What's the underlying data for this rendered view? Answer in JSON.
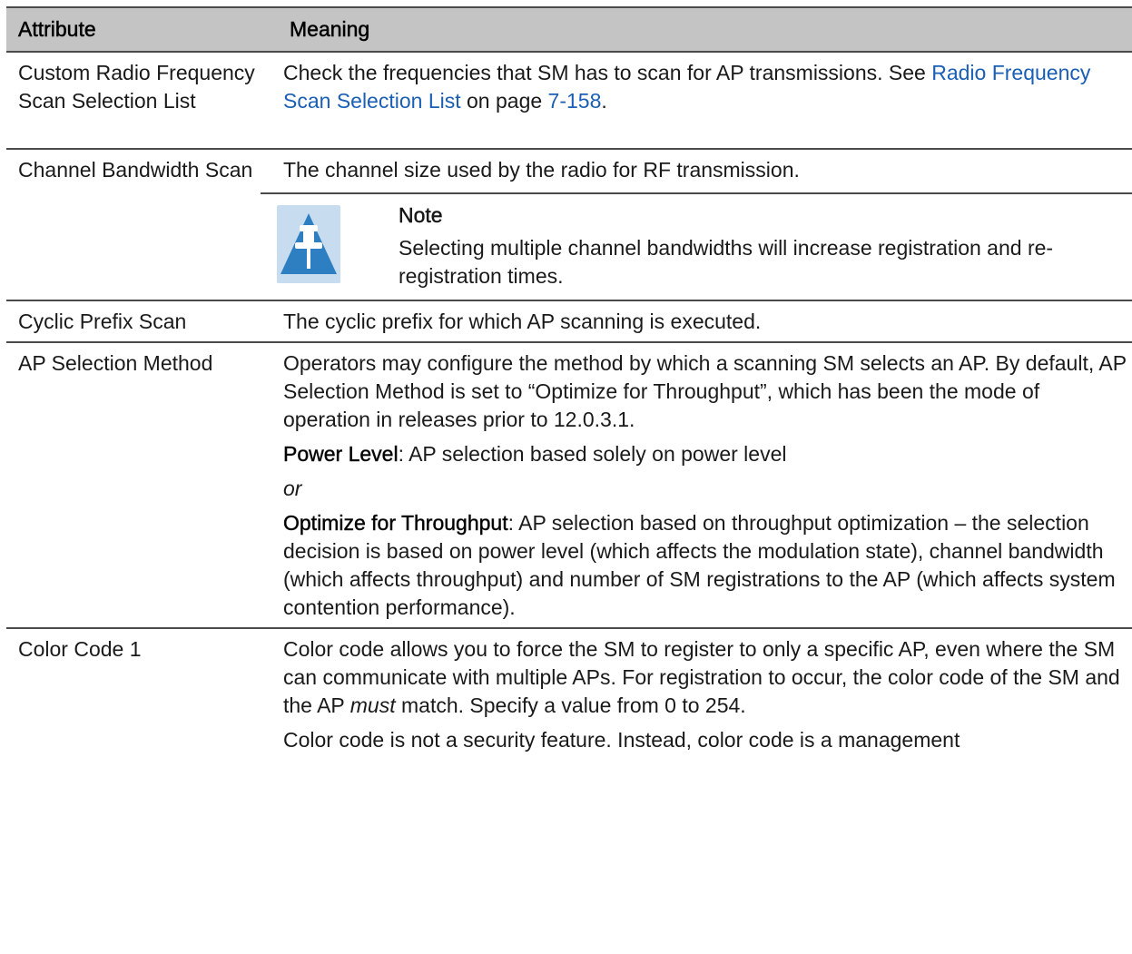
{
  "table": {
    "headers": [
      "Attribute",
      "Meaning"
    ],
    "rows": [
      {
        "attribute": "Custom Radio Frequency Scan Selection List",
        "meaning": {
          "text_before": "Check the frequencies that SM has to scan for AP transmissions. See ",
          "link1": "Radio Frequency Scan Selection List",
          "text_mid": " on page ",
          "link2": "7-158",
          "text_after": "."
        }
      },
      {
        "attribute": "Channel Bandwidth Scan",
        "meaning": {
          "text": "The channel size used by the radio for RF transmission.",
          "note_title": "Note",
          "note_text": "Selecting multiple channel bandwidths will increase registration and re-registration times."
        }
      },
      {
        "attribute": "Cyclic Prefix Scan",
        "meaning": {
          "text": "The cyclic prefix for which AP scanning is executed."
        }
      },
      {
        "attribute": "AP Selection Method",
        "meaning": {
          "p1": "Operators may configure the method by which a scanning SM selects an AP. By default, AP Selection Method is set to “Optimize for Throughput”, which has been the mode of operation in releases prior to 12.0.3.1.",
          "p2_term": "Power Level",
          "p2_text": ": AP selection based solely on power level",
          "p3": "or",
          "p4_term": "Optimize for Throughput",
          "p4_text": ": AP selection based on throughput optimization – the selection decision is based on power level (which affects the modulation state), channel bandwidth (which affects throughput) and number of SM registrations to the AP (which affects system contention performance)."
        }
      },
      {
        "attribute": "Color Code 1",
        "meaning": {
          "p1_before": "Color code allows you to force the SM to register to only a specific AP, even where the SM can communicate with multiple APs. For registration to occur, the color code of the SM and the AP ",
          "p1_em": "must",
          "p1_after": " match. Specify a value from 0 to 254.",
          "p2": "Color code is not a security feature. Instead, color code is a management"
        }
      }
    ]
  },
  "colors": {
    "header_bg": "#c4c4c4",
    "link": "#1a5fb4",
    "rule": "#4a4a4a",
    "note_icon_bg": "#c8dcf0",
    "note_icon_fg": "#2e7fc2"
  },
  "icons": {
    "note": "pushpin-icon"
  }
}
